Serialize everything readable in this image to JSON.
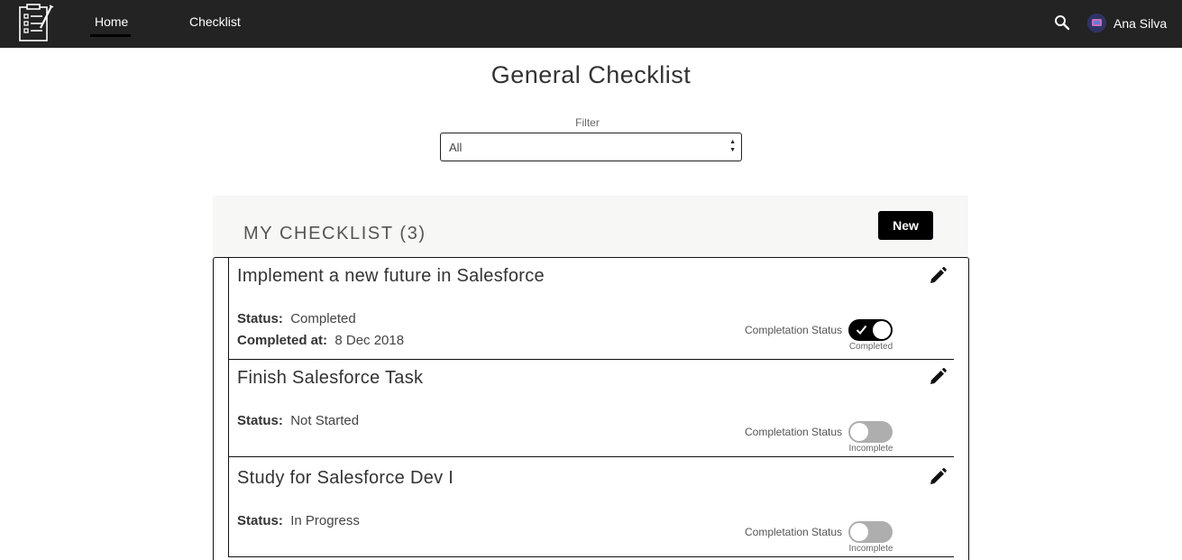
{
  "nav": {
    "logo_icon": "checklist-clipboard-icon",
    "tabs": [
      {
        "label": "Home",
        "active": true
      },
      {
        "label": "Checklist",
        "active": false
      }
    ],
    "search_icon": "search-icon",
    "user_name": "Ana Silva"
  },
  "page": {
    "title": "General Checklist"
  },
  "filter": {
    "label": "Filter",
    "value": "All"
  },
  "panel": {
    "title": "MY CHECKLIST (3)",
    "new_label": "New"
  },
  "items": [
    {
      "title": "Implement a new future in Salesforce",
      "status_label": "Status:",
      "status_value": "Completed",
      "completed_label": "Completed at:",
      "completed_value": "8 Dec 2018",
      "toggle_label": "Completation Status",
      "toggle_on": true,
      "toggle_state": "Completed"
    },
    {
      "title": "Finish Salesforce Task",
      "status_label": "Status:",
      "status_value": "Not Started",
      "toggle_label": "Completation Status",
      "toggle_on": false,
      "toggle_state": "Incomplete"
    },
    {
      "title": "Study for Salesforce Dev I",
      "status_label": "Status:",
      "status_value": "In Progress",
      "toggle_label": "Completation Status",
      "toggle_on": false,
      "toggle_state": "Incomplete"
    }
  ],
  "colors": {
    "topbar": "#232323",
    "accent": "#000000",
    "toggle_off": "#aeaeae",
    "panel_header_bg": "#f7f7f6"
  }
}
